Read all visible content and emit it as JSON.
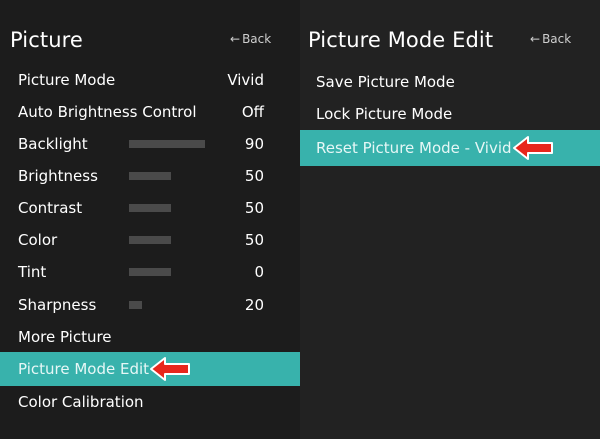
{
  "colors": {
    "highlight": "#38b2ac",
    "bar": "#4a4a4a",
    "pointer": "#e8261c"
  },
  "left_panel": {
    "title": "Picture",
    "back": "Back",
    "items": [
      {
        "label": "Picture Mode",
        "value": "Vivid"
      },
      {
        "label": "Auto Brightness Control",
        "value": "Off"
      },
      {
        "label": "Backlight",
        "value": "90",
        "level": 90
      },
      {
        "label": "Brightness",
        "value": "50",
        "level": 50
      },
      {
        "label": "Contrast",
        "value": "50",
        "level": 50
      },
      {
        "label": "Color",
        "value": "50",
        "level": 50
      },
      {
        "label": "Tint",
        "value": "0",
        "level": 50
      },
      {
        "label": "Sharpness",
        "value": "20",
        "level": 15
      },
      {
        "label": "More Picture"
      },
      {
        "label": "Picture Mode Edit",
        "selected": true,
        "pointer_icon": "red-arrow-left"
      },
      {
        "label": "Color Calibration"
      }
    ]
  },
  "right_panel": {
    "title": "Picture Mode Edit",
    "back": "Back",
    "items": [
      {
        "label": "Save Picture Mode"
      },
      {
        "label": "Lock Picture Mode"
      },
      {
        "label": "Reset Picture Mode - Vivid",
        "selected": true,
        "pointer_icon": "red-arrow-left"
      }
    ]
  }
}
